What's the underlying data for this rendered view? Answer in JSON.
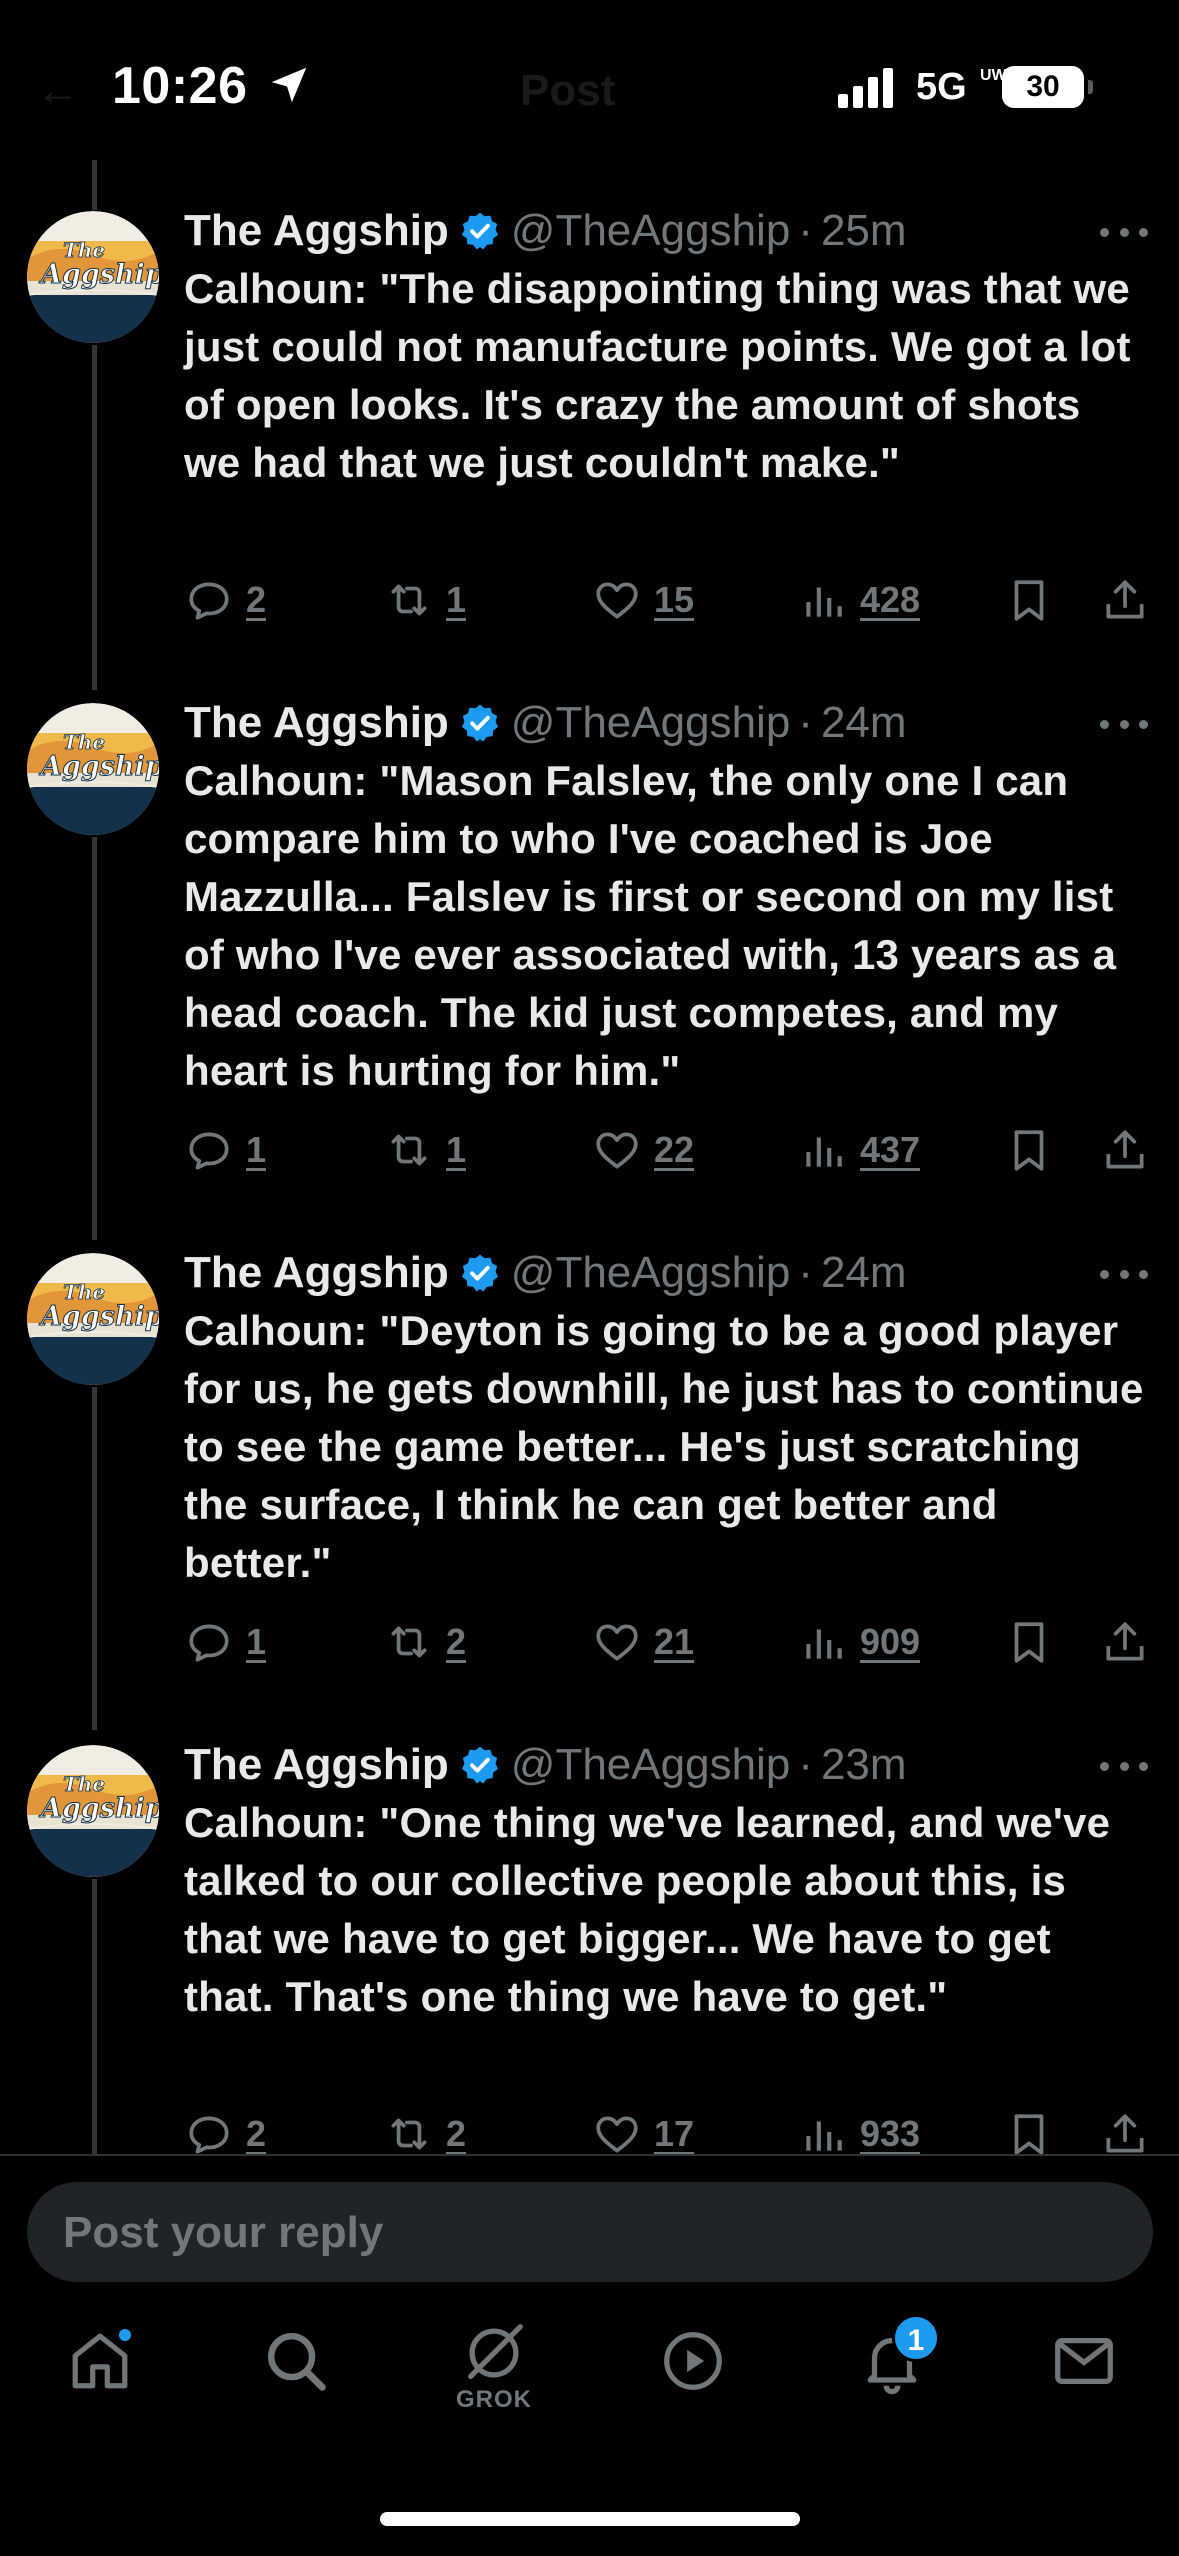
{
  "status_bar": {
    "time": "10:26",
    "network": "5G",
    "network_sub": "UW",
    "battery": "30",
    "back_faint": "←",
    "title_faint": "Post"
  },
  "tweets": [
    {
      "display_name": "The Aggship",
      "handle": "@TheAggship",
      "separator": "·",
      "time_ago": "25m",
      "text": "Calhoun: \"The disappointing thing was that we just could not manufacture points. We got a lot of open looks. It's crazy the amount of shots we had that we just couldn't make.\"",
      "replies": "2",
      "reposts": "1",
      "likes": "15",
      "views": "428"
    },
    {
      "display_name": "The Aggship",
      "handle": "@TheAggship",
      "separator": "·",
      "time_ago": "24m",
      "text": "Calhoun: \"Mason Falslev, the only one I can compare him to who I've coached is Joe Mazzulla... Falslev is first or second on my list of who I've ever associated with, 13 years as a head coach. The kid just competes, and my heart is hurting for him.\"",
      "replies": "1",
      "reposts": "1",
      "likes": "22",
      "views": "437"
    },
    {
      "display_name": "The Aggship",
      "handle": "@TheAggship",
      "separator": "·",
      "time_ago": "24m",
      "text": "Calhoun: \"Deyton is going to be a good player for us, he gets downhill, he just has to continue to see the game better... He's just scratching the surface, I think he can get better and better.\"",
      "replies": "1",
      "reposts": "2",
      "likes": "21",
      "views": "909"
    },
    {
      "display_name": "The Aggship",
      "handle": "@TheAggship",
      "separator": "·",
      "time_ago": "23m",
      "text": "Calhoun: \"One thing we've learned, and we've talked to our collective people about this, is that we have to get bigger... We have to get that. That's one thing we have to get.\"",
      "replies": "2",
      "reposts": "2",
      "likes": "17",
      "views": "933"
    }
  ],
  "avatar_logo": {
    "line1": "The",
    "line2": "Aggship"
  },
  "reply_bar": {
    "placeholder": "Post your reply"
  },
  "bottom_nav": {
    "grok_label": "GROK",
    "notifications_badge": "1"
  },
  "icons": {
    "reply": "reply-icon",
    "repost": "repost-icon",
    "like": "heart-icon",
    "views": "views-icon",
    "bookmark": "bookmark-icon",
    "share": "share-icon",
    "verified": "verified-badge-icon",
    "more": "more-icon"
  },
  "colors": {
    "background": "#000000",
    "text": "#e7e9ea",
    "muted": "#71767b",
    "accent": "#1d9bf0"
  }
}
